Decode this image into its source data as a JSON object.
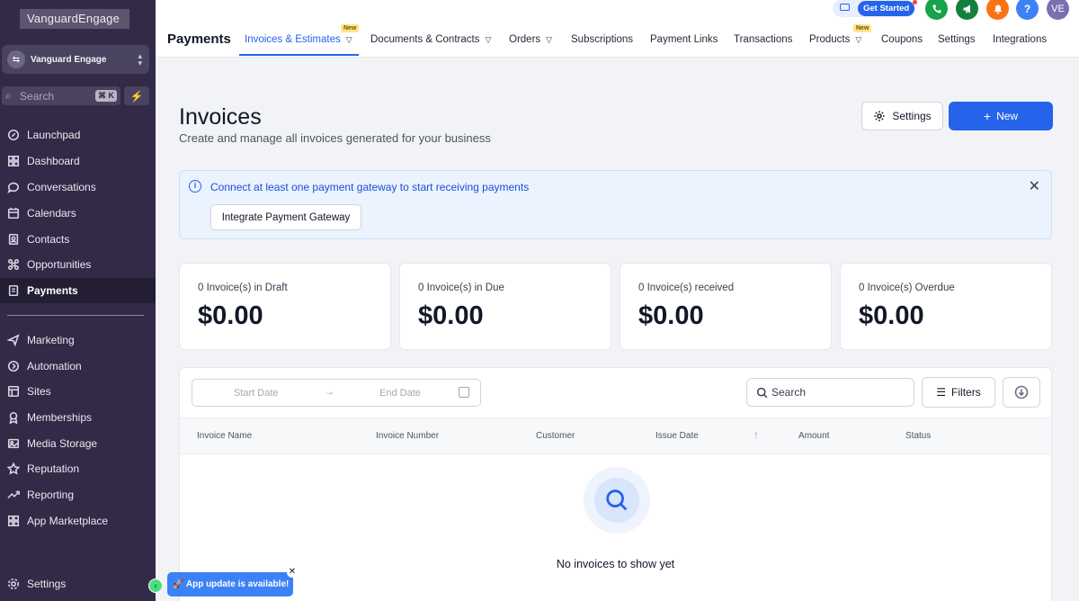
{
  "sidebar": {
    "brand": "VanguardEngage",
    "account_name": "Vanguard Engage",
    "search_placeholder": "Search",
    "search_shortcut": "⌘ K",
    "items": [
      {
        "label": "Launchpad",
        "icon": "rocket-icon"
      },
      {
        "label": "Dashboard",
        "icon": "dashboard-icon"
      },
      {
        "label": "Conversations",
        "icon": "chat-icon"
      },
      {
        "label": "Calendars",
        "icon": "calendar-icon"
      },
      {
        "label": "Contacts",
        "icon": "contacts-icon"
      },
      {
        "label": "Opportunities",
        "icon": "opportunities-icon"
      },
      {
        "label": "Payments",
        "icon": "payments-icon",
        "active": true
      },
      {
        "label": "Marketing",
        "icon": "send-icon"
      },
      {
        "label": "Automation",
        "icon": "automation-icon"
      },
      {
        "label": "Sites",
        "icon": "sites-icon"
      },
      {
        "label": "Memberships",
        "icon": "membership-icon"
      },
      {
        "label": "Media Storage",
        "icon": "media-icon"
      },
      {
        "label": "Reputation",
        "icon": "star-icon"
      },
      {
        "label": "Reporting",
        "icon": "chart-icon"
      },
      {
        "label": "App Marketplace",
        "icon": "marketplace-icon"
      }
    ],
    "settings_label": "Settings"
  },
  "topbar": {
    "title": "Payments",
    "tabs": [
      {
        "label": "Invoices & Estimates",
        "active": true,
        "dropdown": true,
        "badge": "New"
      },
      {
        "label": "Documents & Contracts",
        "dropdown": true
      },
      {
        "label": "Orders",
        "dropdown": true
      },
      {
        "label": "Subscriptions"
      },
      {
        "label": "Payment Links"
      },
      {
        "label": "Transactions"
      },
      {
        "label": "Products",
        "dropdown": true,
        "badge": "New"
      },
      {
        "label": "Coupons"
      },
      {
        "label": "Settings"
      },
      {
        "label": "Integrations"
      }
    ],
    "get_started": "Get Started",
    "help_label": "?",
    "avatar_initials": "VE",
    "colors": {
      "phone": "#16a34a",
      "megaphone": "#15803d",
      "bell": "#f97316",
      "help": "#3b82f6",
      "avatar": "#7c6fb0"
    }
  },
  "page": {
    "title": "Invoices",
    "subtitle": "Create and manage all invoices generated for your business",
    "settings_button": "Settings",
    "new_button": "New"
  },
  "banner": {
    "message": "Connect at least one payment gateway to start receiving payments",
    "button": "Integrate Payment Gateway"
  },
  "stats": [
    {
      "label": "0 Invoice(s) in Draft",
      "value": "$0.00"
    },
    {
      "label": "0 Invoice(s) in Due",
      "value": "$0.00"
    },
    {
      "label": "0 Invoice(s) received",
      "value": "$0.00"
    },
    {
      "label": "0 Invoice(s) Overdue",
      "value": "$0.00"
    }
  ],
  "table": {
    "start_date_placeholder": "Start Date",
    "end_date_placeholder": "End Date",
    "search_placeholder": "Search",
    "filters_label": "Filters",
    "columns": [
      "Invoice Name",
      "Invoice Number",
      "Customer",
      "Issue Date",
      "Amount",
      "Status"
    ],
    "empty_message": "No invoices to show yet"
  },
  "toast": {
    "message": "🚀 App update is available!"
  }
}
